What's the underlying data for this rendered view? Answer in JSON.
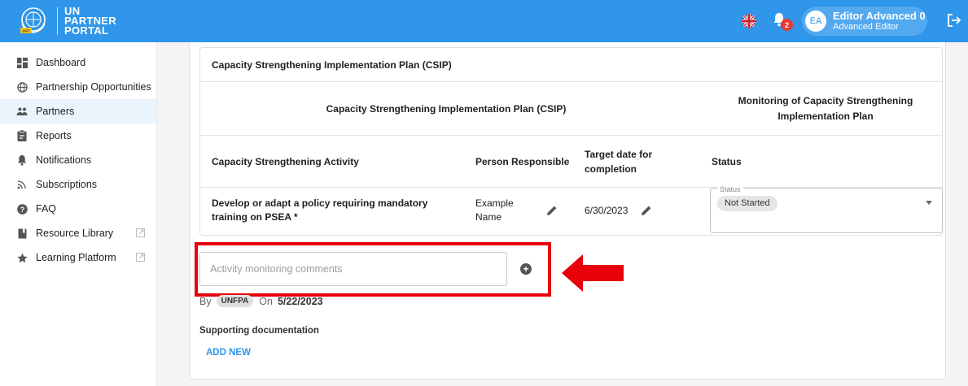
{
  "header": {
    "logo_lines": [
      "UN",
      "PARTNER",
      "PORTAL"
    ],
    "notification_count": "2",
    "user": {
      "initials": "EA",
      "name": "Editor Advanced 0",
      "role": "Advanced Editor"
    },
    "brand_color": "#2f96ea"
  },
  "sidebar": {
    "items": [
      {
        "label": "Dashboard",
        "icon": "dashboard-icon"
      },
      {
        "label": "Partnership Opportunities",
        "icon": "globe-icon"
      },
      {
        "label": "Partners",
        "icon": "people-icon",
        "active": true
      },
      {
        "label": "Reports",
        "icon": "clipboard-icon"
      },
      {
        "label": "Notifications",
        "icon": "bell-icon"
      },
      {
        "label": "Subscriptions",
        "icon": "rss-icon"
      },
      {
        "label": "FAQ",
        "icon": "help-icon"
      },
      {
        "label": "Resource Library",
        "icon": "book-icon",
        "external": true
      },
      {
        "label": "Learning Platform",
        "icon": "star-icon",
        "external": true
      }
    ]
  },
  "csip": {
    "title": "Capacity Strengthening Implementation Plan (CSIP)",
    "group_headers": {
      "plan": "Capacity Strengthening Implementation Plan (CSIP)",
      "monitoring": "Monitoring of Capacity Strengthening Implementation Plan"
    },
    "columns": {
      "activity": "Capacity Strengthening Activity",
      "person": "Person Responsible",
      "target_date": "Target date for completion",
      "status": "Status"
    },
    "row": {
      "activity": "Develop or adapt a policy requiring mandatory training on PSEA *",
      "person": "Example Name",
      "target_date": "6/30/2023",
      "status_label": "Status",
      "status_value": "Not Started"
    }
  },
  "monitoring": {
    "comment_placeholder": "Activity monitoring comments",
    "by_label": "By",
    "org": "UNFPA",
    "on_label": "On",
    "date": "5/22/2023",
    "supporting_label": "Supporting documentation",
    "add_new_label": "ADD NEW"
  },
  "annotation": {
    "highlight_color": "#e8000b"
  }
}
